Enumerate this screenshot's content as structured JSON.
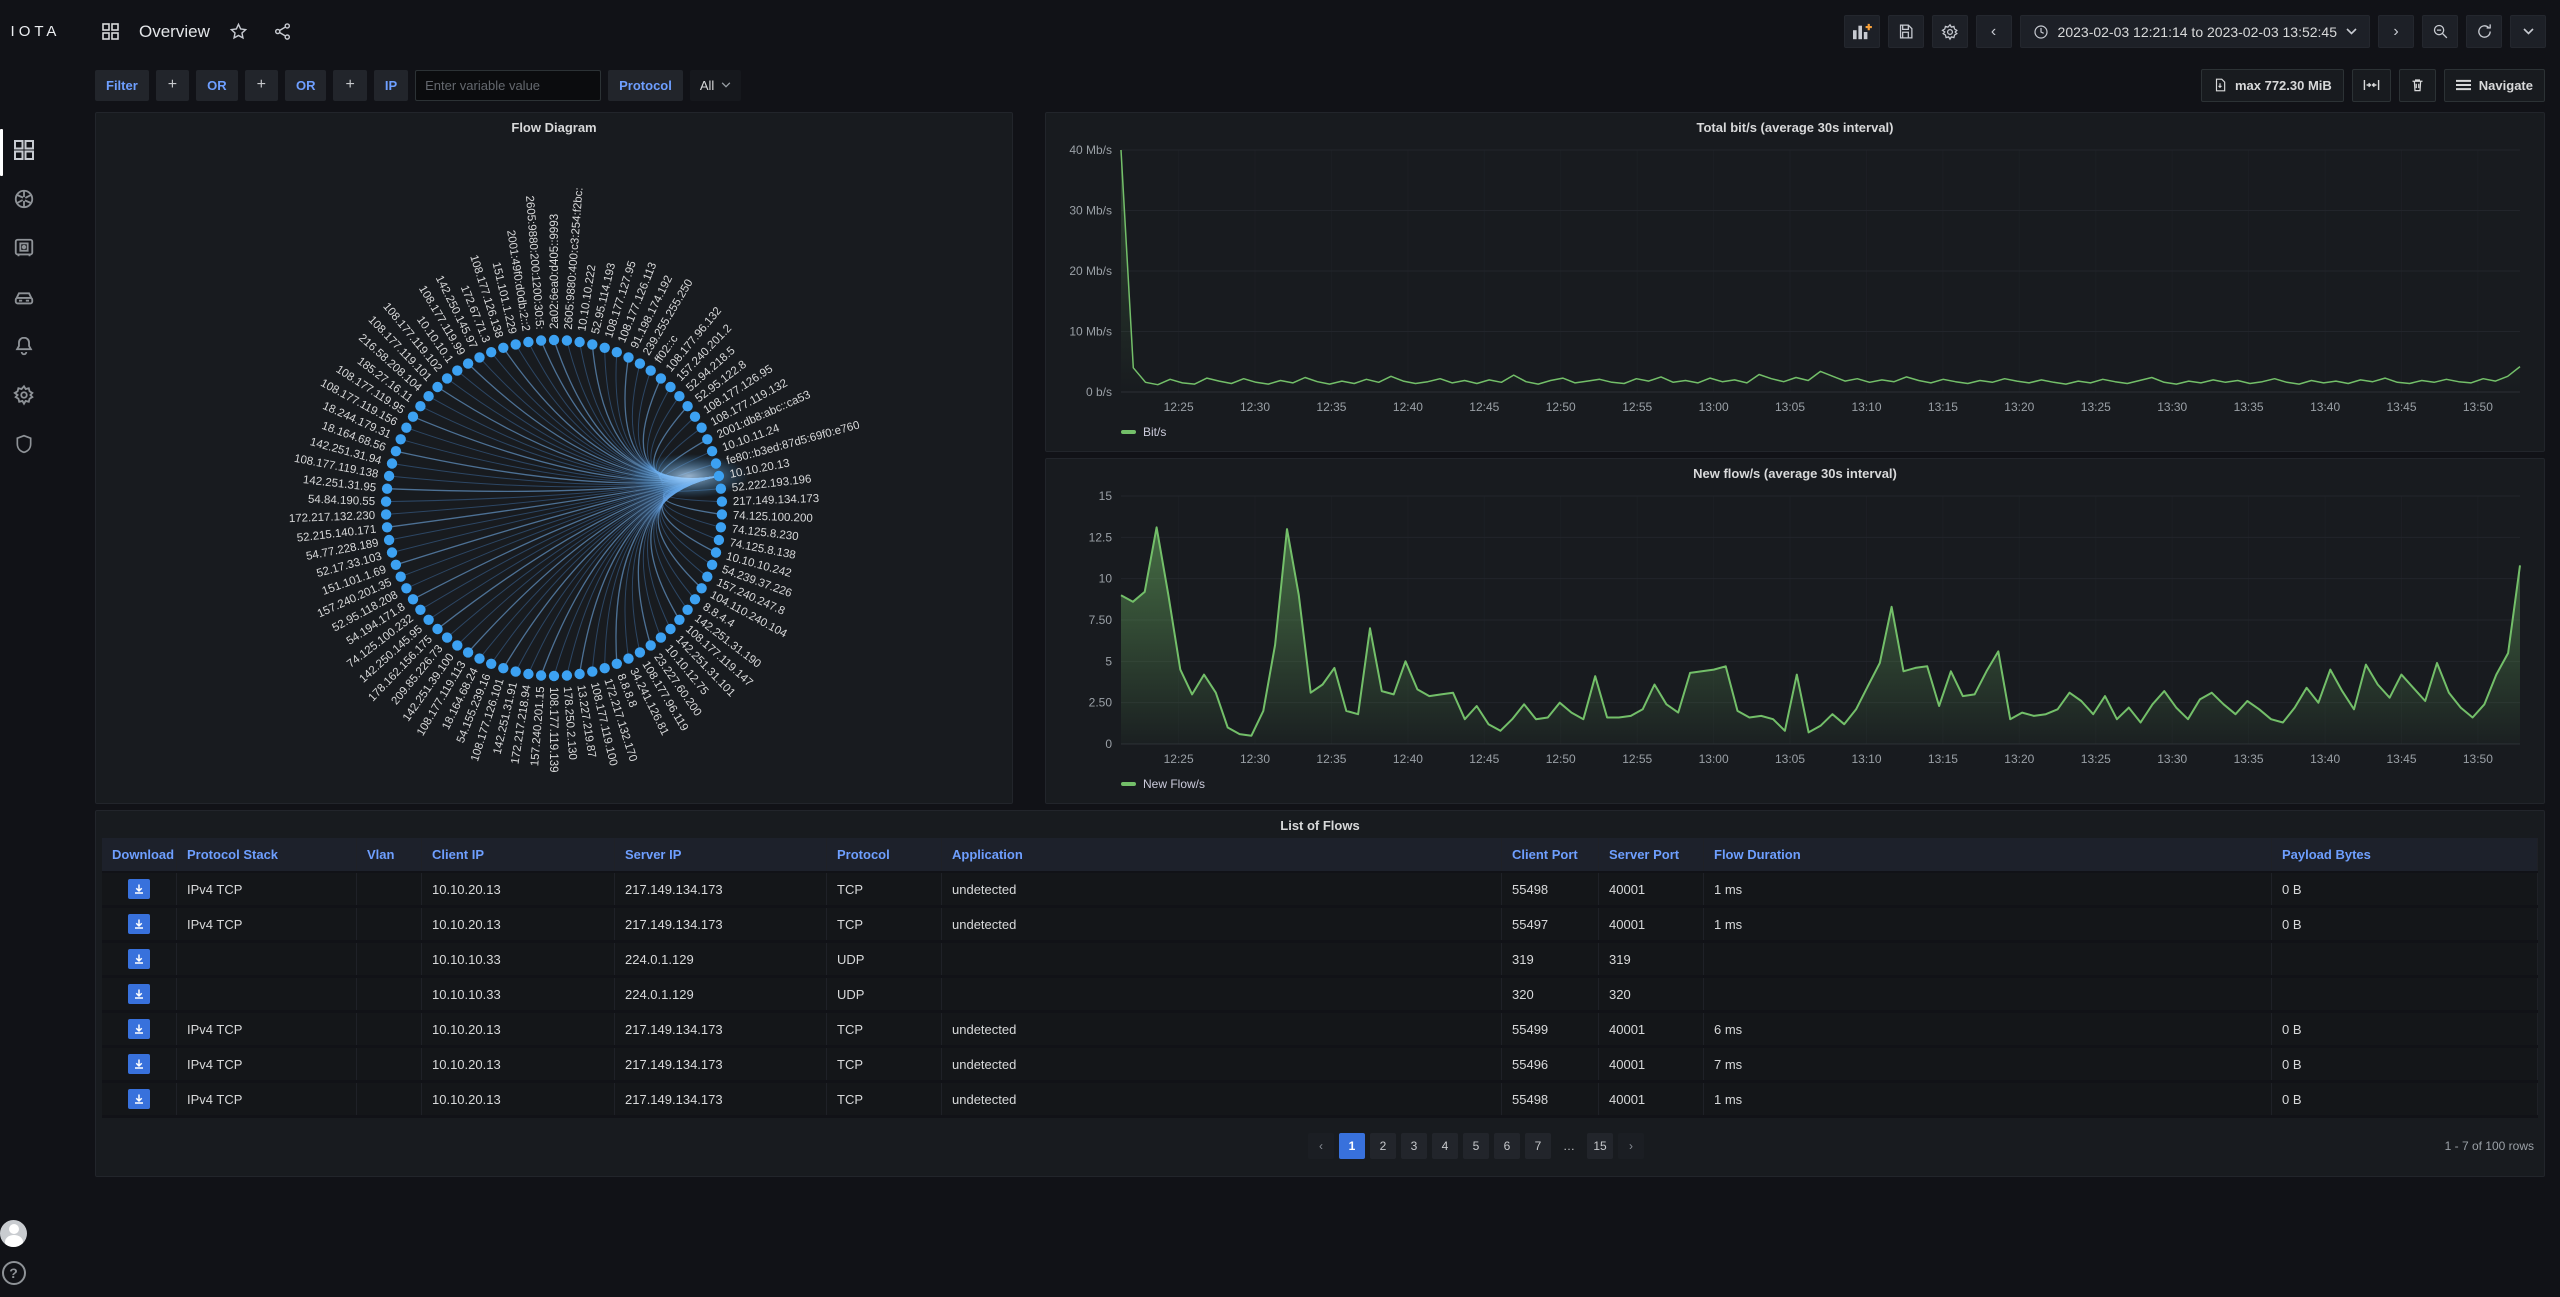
{
  "colors": {
    "accent_blue": "#3871dc",
    "link_blue": "#6e9fff",
    "green": "#73bf69",
    "node_blue": "#3ca1f2",
    "edge_blue": "#4e8fd6"
  },
  "nav": {
    "logo": "IOTA",
    "title": "Overview",
    "time_range": "2023-02-03 12:21:14 to 2023-02-03 13:52:45"
  },
  "toolbar": {
    "filter_label": "Filter",
    "plus": "+",
    "or1": "OR",
    "or2": "OR",
    "ip_label": "IP",
    "ip_placeholder": "Enter variable value",
    "ip_value": "",
    "protocol_label": "Protocol",
    "protocol_value": "All",
    "max_size": "max 772.30 MiB",
    "navigate": "Navigate"
  },
  "flow_diagram": {
    "title": "Flow Diagram",
    "hub": "10.10.20.13",
    "nodes": [
      "2a02:6ea0:d405::9993",
      "2605:9880:400:c3:254:f2bc:",
      "10.10.10.222",
      "52.95.114.193",
      "108.177.127.95",
      "108.177.126.113",
      "91.198.174.192",
      "239.255.255.250",
      "ff02::c",
      "108.177.96.132",
      "157.240.201.2",
      "52.94.218.5",
      "52.95.122.8",
      "108.177.126.95",
      "108.177.119.132",
      "2001:db8:abc::ca53",
      "10.10.11.24",
      "fe80::b3ed:87d5:69f0:e760",
      "10.10.20.13",
      "52.222.193.196",
      "217.149.134.173",
      "74.125.100.200",
      "74.125.8.230",
      "74.125.8.138",
      "10.10.10.242",
      "54.239.37.226",
      "157.240.247.8",
      "104.110.240.104",
      "8.8.4.4",
      "142.251.31.190",
      "108.177.119.147",
      "142.251.31.101",
      "10.10.12.75",
      "23.227.60.200",
      "108.177.96.119",
      "34.241.126.81",
      "8.8.8.8",
      "172.217.132.170",
      "108.177.119.100",
      "13.227.219.87",
      "178.250.2.130",
      "108.177.119.139",
      "157.240.201.15",
      "172.217.218.94",
      "142.251.31.91",
      "108.177.126.101",
      "54.155.239.16",
      "18.164.68.24",
      "108.177.119.113",
      "142.251.39.100",
      "209.85.226.73",
      "178.162.156.175",
      "142.250.145.95",
      "74.125.100.232",
      "54.194.171.8",
      "52.95.118.208",
      "157.240.201.35",
      "151.101.1.69",
      "52.17.33.103",
      "54.77.228.189",
      "52.215.140.171",
      "172.217.132.230",
      "54.84.190.55",
      "142.251.31.95",
      "108.177.119.138",
      "142.251.31.94",
      "18.164.68.56",
      "18.244.179.31",
      "108.177.119.156",
      "108.177.119.95",
      "185.27.16.11",
      "216.58.208.104",
      "108.177.119.101",
      "108.177.119.102",
      "10.10.10.1",
      "108.177.119.99",
      "142.250.145.97",
      "172.67.71.3",
      "108.177.126.138",
      "151.101.1.229",
      "2001:49f0:d0db:2::2",
      "2605:9880:200:1200:30:5:"
    ]
  },
  "chart_data": [
    {
      "type": "line",
      "title": "Total bit/s (average 30s interval)",
      "legend": [
        "Bit/s"
      ],
      "xlabel": "",
      "ylabel": "",
      "ylim": [
        0,
        40
      ],
      "grid": true,
      "legend_position": "bottom-left",
      "yticks": [
        {
          "label": "0 b/s",
          "value": 0
        },
        {
          "label": "10 Mb/s",
          "value": 10
        },
        {
          "label": "20 Mb/s",
          "value": 20
        },
        {
          "label": "30 Mb/s",
          "value": 30
        },
        {
          "label": "40 Mb/s",
          "value": 40
        }
      ],
      "xticks": [
        {
          "label": "12:25",
          "frac": 0.0412
        },
        {
          "label": "12:30",
          "frac": 0.0958
        },
        {
          "label": "12:35",
          "frac": 0.1504
        },
        {
          "label": "12:40",
          "frac": 0.2051
        },
        {
          "label": "12:45",
          "frac": 0.2597
        },
        {
          "label": "12:50",
          "frac": 0.3143
        },
        {
          "label": "12:55",
          "frac": 0.369
        },
        {
          "label": "13:00",
          "frac": 0.4236
        },
        {
          "label": "13:05",
          "frac": 0.4782
        },
        {
          "label": "13:10",
          "frac": 0.5329
        },
        {
          "label": "13:15",
          "frac": 0.5875
        },
        {
          "label": "13:20",
          "frac": 0.6421
        },
        {
          "label": "13:25",
          "frac": 0.6968
        },
        {
          "label": "13:30",
          "frac": 0.7514
        },
        {
          "label": "13:35",
          "frac": 0.806
        },
        {
          "label": "13:40",
          "frac": 0.8607
        },
        {
          "label": "13:45",
          "frac": 0.9153
        },
        {
          "label": "13:50",
          "frac": 0.9699
        }
      ],
      "values": [
        40,
        4,
        1.6,
        1.2,
        2.1,
        1.5,
        1.3,
        2.3,
        1.8,
        1.4,
        2.2,
        1.6,
        1.3,
        1.9,
        1.5,
        2.4,
        1.7,
        1.3,
        1.8,
        1.4,
        2.1,
        1.6,
        2.6,
        1.8,
        1.4,
        1.7,
        2.2,
        1.5,
        1.9,
        1.4,
        2.0,
        1.6,
        2.8,
        1.7,
        1.3,
        1.9,
        2.3,
        1.5,
        1.8,
        2.1,
        1.6,
        1.4,
        2.2,
        1.8,
        2.5,
        1.6,
        1.9,
        1.5,
        2.3,
        1.7,
        2.0,
        1.5,
        2.9,
        2.2,
        1.7,
        2.4,
        1.9,
        3.4,
        2.6,
        1.8,
        2.2,
        1.6,
        2.0,
        1.7,
        2.5,
        1.9,
        1.5,
        2.1,
        1.7,
        1.4,
        1.9,
        1.6,
        2.2,
        1.8,
        1.5,
        2.0,
        1.6,
        1.3,
        1.8,
        1.5,
        2.1,
        1.7,
        1.4,
        1.9,
        2.4,
        1.6,
        1.3,
        1.8,
        1.5,
        2.0,
        1.6,
        1.9,
        1.4,
        1.7,
        2.2,
        1.6,
        1.3,
        1.9,
        1.5,
        1.8,
        1.4,
        2.0,
        1.7,
        2.3,
        1.6,
        1.4,
        1.9,
        1.6,
        2.1,
        1.7,
        1.5,
        2.2,
        1.8,
        2.6,
        4.2
      ]
    },
    {
      "type": "area",
      "title": "New flow/s (average 30s interval)",
      "legend": [
        "New Flow/s"
      ],
      "xlabel": "",
      "ylabel": "",
      "ylim": [
        0,
        15
      ],
      "grid": true,
      "legend_position": "bottom-left",
      "yticks": [
        {
          "label": "0",
          "value": 0
        },
        {
          "label": "2.50",
          "value": 2.5
        },
        {
          "label": "5",
          "value": 5
        },
        {
          "label": "7.50",
          "value": 7.5
        },
        {
          "label": "10",
          "value": 10
        },
        {
          "label": "12.5",
          "value": 12.5
        },
        {
          "label": "15",
          "value": 15
        }
      ],
      "xticks": [
        {
          "label": "12:25",
          "frac": 0.0412
        },
        {
          "label": "12:30",
          "frac": 0.0958
        },
        {
          "label": "12:35",
          "frac": 0.1504
        },
        {
          "label": "12:40",
          "frac": 0.2051
        },
        {
          "label": "12:45",
          "frac": 0.2597
        },
        {
          "label": "12:50",
          "frac": 0.3143
        },
        {
          "label": "12:55",
          "frac": 0.369
        },
        {
          "label": "13:00",
          "frac": 0.4236
        },
        {
          "label": "13:05",
          "frac": 0.4782
        },
        {
          "label": "13:10",
          "frac": 0.5329
        },
        {
          "label": "13:15",
          "frac": 0.5875
        },
        {
          "label": "13:20",
          "frac": 0.6421
        },
        {
          "label": "13:25",
          "frac": 0.6968
        },
        {
          "label": "13:30",
          "frac": 0.7514
        },
        {
          "label": "13:35",
          "frac": 0.806
        },
        {
          "label": "13:40",
          "frac": 0.8607
        },
        {
          "label": "13:45",
          "frac": 0.9153
        },
        {
          "label": "13:50",
          "frac": 0.9699
        }
      ],
      "values": [
        9,
        8.6,
        9.2,
        13.1,
        9,
        4.5,
        3,
        4.2,
        3.1,
        1,
        0.6,
        0.5,
        2,
        6,
        13,
        9,
        3.1,
        3.6,
        4.6,
        2,
        1.8,
        7,
        3.2,
        3,
        5,
        3.3,
        2.9,
        3,
        3.1,
        1.5,
        2.3,
        1.2,
        0.8,
        1.5,
        2.4,
        1.5,
        1.6,
        2.5,
        1.9,
        1.5,
        4.1,
        1.6,
        1.6,
        1.7,
        2.1,
        3.6,
        2.4,
        1.9,
        4.3,
        4.4,
        4.5,
        4.7,
        2,
        1.6,
        1.7,
        1.5,
        0.8,
        4.2,
        0.7,
        1.1,
        1.8,
        1.2,
        2.1,
        3.5,
        4.9,
        8.3,
        4.4,
        4.6,
        4.7,
        2.3,
        4.4,
        2.9,
        3,
        4.4,
        5.6,
        1.5,
        1.9,
        1.7,
        1.8,
        2.1,
        3.1,
        2.6,
        1.8,
        2.9,
        1.5,
        2.2,
        1.3,
        2.4,
        3.2,
        2.2,
        1.5,
        2.7,
        3.1,
        2.4,
        1.8,
        2.6,
        2.1,
        1.5,
        1.3,
        2.2,
        3.4,
        2.5,
        4.5,
        3.2,
        2.1,
        4.8,
        3.6,
        2.8,
        4.2,
        3.4,
        2.6,
        4.9,
        3.1,
        2.2,
        1.6,
        2.4,
        4.2,
        5.5,
        10.8
      ]
    }
  ],
  "table": {
    "title": "List of Flows",
    "columns": [
      "Download",
      "Protocol Stack",
      "Vlan",
      "Client IP",
      "Server IP",
      "Protocol",
      "Application",
      "Client Port",
      "Server Port",
      "Flow Duration",
      "Payload Bytes"
    ],
    "rows": [
      [
        "IPv4 TCP",
        "",
        "10.10.20.13",
        "217.149.134.173",
        "TCP",
        "undetected",
        "55498",
        "40001",
        "1 ms",
        "0 B"
      ],
      [
        "IPv4 TCP",
        "",
        "10.10.20.13",
        "217.149.134.173",
        "TCP",
        "undetected",
        "55497",
        "40001",
        "1 ms",
        "0 B"
      ],
      [
        "",
        "",
        "10.10.10.33",
        "224.0.1.129",
        "UDP",
        "",
        "319",
        "319",
        "",
        ""
      ],
      [
        "",
        "",
        "10.10.10.33",
        "224.0.1.129",
        "UDP",
        "",
        "320",
        "320",
        "",
        ""
      ],
      [
        "IPv4 TCP",
        "",
        "10.10.20.13",
        "217.149.134.173",
        "TCP",
        "undetected",
        "55499",
        "40001",
        "6 ms",
        "0 B"
      ],
      [
        "IPv4 TCP",
        "",
        "10.10.20.13",
        "217.149.134.173",
        "TCP",
        "undetected",
        "55496",
        "40001",
        "7 ms",
        "0 B"
      ],
      [
        "IPv4 TCP",
        "",
        "10.10.20.13",
        "217.149.134.173",
        "TCP",
        "undetected",
        "55498",
        "40001",
        "1 ms",
        "0 B"
      ]
    ],
    "pagination": {
      "pages": [
        "1",
        "2",
        "3",
        "4",
        "5",
        "6",
        "7",
        "…",
        "15"
      ],
      "active": "1",
      "prev": "‹",
      "next": "›",
      "rows_info": "1 - 7 of 100 rows"
    }
  }
}
